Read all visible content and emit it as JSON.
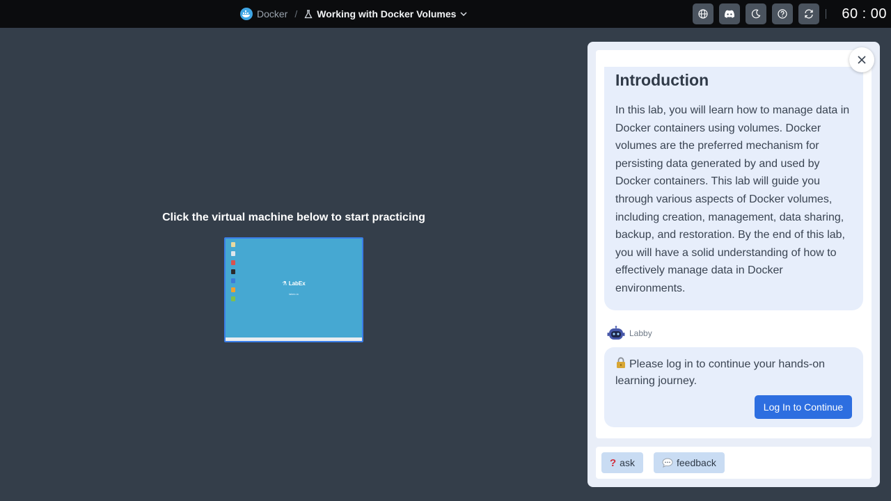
{
  "header": {
    "breadcrumb_root": "Docker",
    "breadcrumb_sep": "/",
    "lab_title": "Working with Docker Volumes",
    "timer": "60 : 00",
    "icons": [
      "globe-icon",
      "discord-icon",
      "moon-icon",
      "help-icon",
      "refresh-icon"
    ]
  },
  "vm": {
    "prompt": "Click the virtual machine below to start practicing",
    "logo_text": "LabEx",
    "logo_sub": "labex.io"
  },
  "panel": {
    "intro_title": "Introduction",
    "intro_body": "In this lab, you will learn how to manage data in Docker containers using volumes. Docker volumes are the preferred mechanism for persisting data generated by and used by Docker containers. This lab will guide you through various aspects of Docker volumes, including creation, management, data sharing, backup, and restoration. By the end of this lab, you will have a solid understanding of how to effectively manage data in Docker environments.",
    "assistant_name": "Labby",
    "login_message": "Please log in to continue your hands-on learning journey.",
    "login_button": "Log In to Continue",
    "ask_label": "ask",
    "feedback_label": "feedback"
  },
  "colors": {
    "topbar": "#0b0c0e",
    "background": "#343e4a",
    "accent": "#2d6ee0",
    "card": "#e7eefb",
    "chip": "#c9dcf3"
  }
}
